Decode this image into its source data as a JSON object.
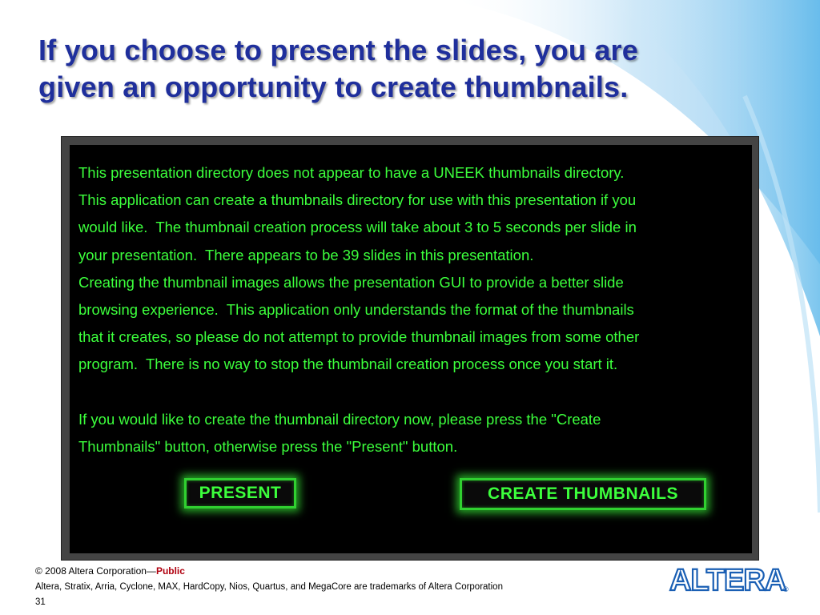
{
  "slide": {
    "title_line1": "If you choose to present the slides, you are",
    "title_line2": "given an opportunity to create thumbnails."
  },
  "dialog": {
    "message": "This presentation directory does not appear to have a UNEEK thumbnails directory.\nThis application can create a thumbnails directory for use with this presentation if you\nwould like.  The thumbnail creation process will take about 3 to 5 seconds per slide in\nyour presentation.  There appears to be 39 slides in this presentation.\nCreating the thumbnail images allows the presentation GUI to provide a better slide\nbrowsing experience.  This application only understands the format of the thumbnails\nthat it creates, so please do not attempt to provide thumbnail images from some other\nprogram.  There is no way to stop the thumbnail creation process once you start it.\n\nIf you would like to create the thumbnail directory now, please press the \"Create\nThumbnails\" button, otherwise press the \"Present\" button.",
    "present_label": "PRESENT",
    "create_label": "CREATE THUMBNAILS",
    "text_color": "#3cff3c",
    "background_color": "#000000"
  },
  "footer": {
    "copyright": "© 2008 Altera Corporation—",
    "public_label": "Public",
    "trademarks": "Altera, Stratix, Arria, Cyclone, MAX, HardCopy, Nios, Quartus, and MegaCore are trademarks of Altera Corporation",
    "page_number": "31"
  },
  "logo": {
    "text": "ALTERA",
    "registered": "®",
    "color": "#1a5fb4"
  },
  "colors": {
    "title": "#1f2f9c",
    "public": "#b0000f"
  }
}
